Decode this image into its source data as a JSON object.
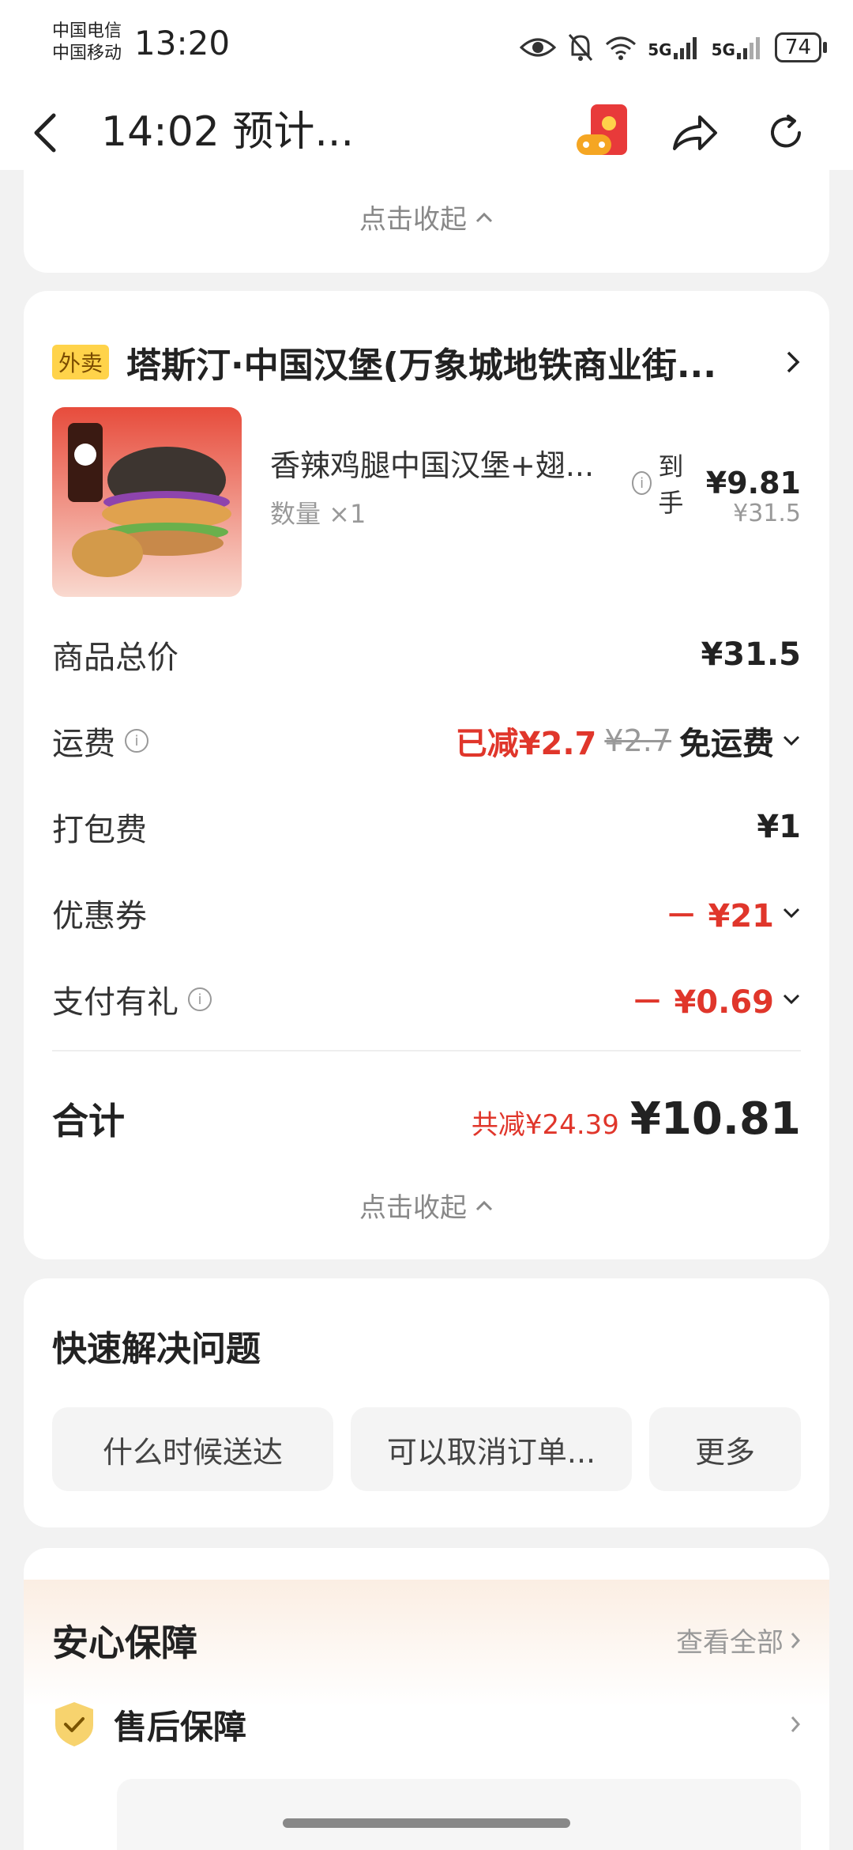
{
  "status_bar": {
    "carrier1": "中国电信",
    "carrier2": "中国移动",
    "time": "13:20",
    "net1": "5G",
    "net2": "5G",
    "battery": "74"
  },
  "header": {
    "title": "14:02 预计...",
    "icons": [
      "back-icon",
      "game-redpacket-icon",
      "share-icon",
      "refresh-icon"
    ]
  },
  "top_card": {
    "collapse_label": "点击收起"
  },
  "order": {
    "tag": "外卖",
    "shop_name": "塔斯汀·中国汉堡(万象城地铁商业街...",
    "item": {
      "name": "香辣鸡腿中国汉堡+翅...",
      "quantity": "数量 ×1",
      "final_prefix": "到手",
      "final_price": "¥9.81",
      "original_price": "¥31.5"
    },
    "rows": {
      "goods_total_label": "商品总价",
      "goods_total_value": "¥31.5",
      "shipping_label": "运费",
      "shipping_reduced": "已减¥2.7",
      "shipping_original": "¥2.7",
      "shipping_free": "免运费",
      "packing_label": "打包费",
      "packing_value": "¥1",
      "coupon_label": "优惠券",
      "coupon_value": "－ ¥21",
      "paygift_label": "支付有礼",
      "paygift_value": "－ ¥0.69"
    },
    "total_label": "合计",
    "total_saved": "共减¥24.39",
    "total_value": "¥10.81",
    "collapse_label": "点击收起"
  },
  "quick": {
    "title": "快速解决问题",
    "chips": [
      "什么时候送达",
      "可以取消订单...",
      "更多"
    ]
  },
  "assurance": {
    "title": "安心保障",
    "view_all": "查看全部",
    "item": "售后保障"
  },
  "colors": {
    "accent_red": "#e0362b",
    "tag_yellow": "#ffd34a"
  }
}
